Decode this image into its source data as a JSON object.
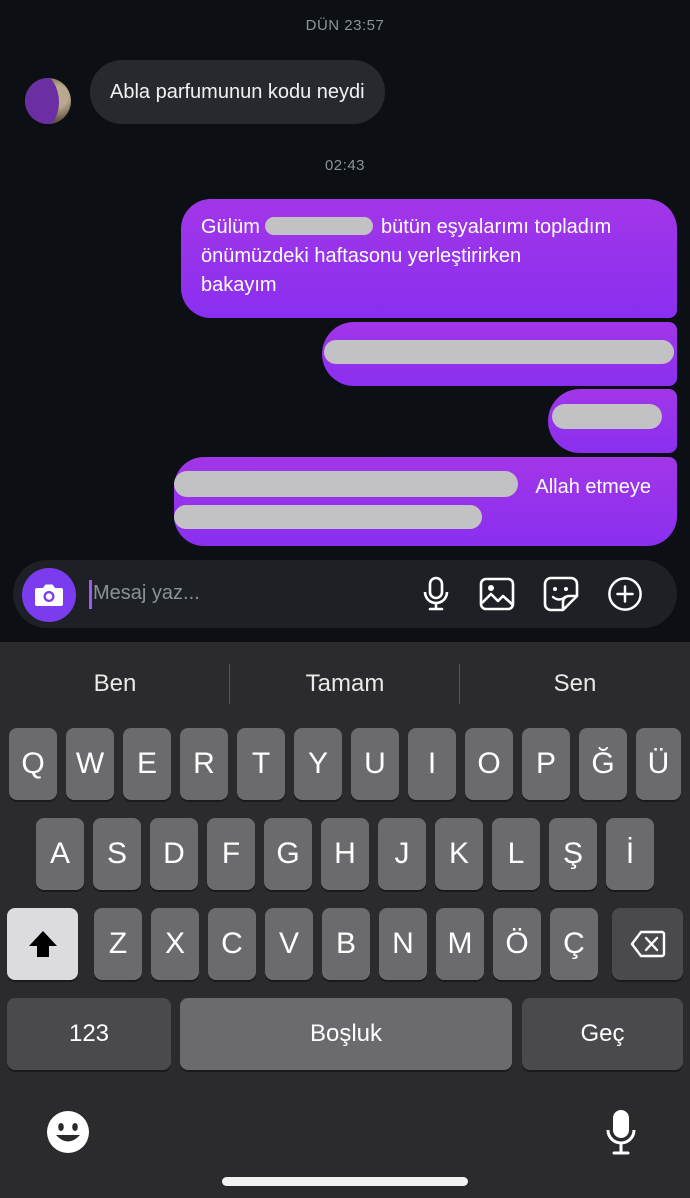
{
  "chat": {
    "timestamp_1": "DÜN 23:57",
    "incoming_message": "Abla parfumunun kodu neydi",
    "timestamp_2": "02:43",
    "outgoing": {
      "msg1_start": "Gülüm",
      "msg1_rest_line1": "bütün eşyalarımı topladım",
      "msg1_line2": "önümüzdeki haftasonu yerleştirirken",
      "msg1_line3": "bakayım",
      "msg4_visible": "Allah etmeye"
    }
  },
  "composer": {
    "placeholder": "Mesaj yaz..."
  },
  "keyboard": {
    "suggestions": [
      "Ben",
      "Tamam",
      "Sen"
    ],
    "row1": [
      "Q",
      "W",
      "E",
      "R",
      "T",
      "Y",
      "U",
      "I",
      "O",
      "P",
      "Ğ",
      "Ü"
    ],
    "row2": [
      "A",
      "S",
      "D",
      "F",
      "G",
      "H",
      "J",
      "K",
      "L",
      "Ş",
      "İ"
    ],
    "row3": [
      "Z",
      "X",
      "C",
      "V",
      "B",
      "N",
      "M",
      "Ö",
      "Ç"
    ],
    "numbers_label": "123",
    "space_label": "Boşluk",
    "return_label": "Geç"
  },
  "icons": {
    "camera": "camera-icon",
    "mic": "microphone-icon",
    "gallery": "image-icon",
    "sticker": "sticker-icon",
    "add": "plus-circle-icon",
    "shift": "shift-icon",
    "backspace": "backspace-icon",
    "emoji": "emoji-icon",
    "dictation": "dictation-mic-icon"
  },
  "colors": {
    "outgoing_bubble": "#8a2ff0",
    "incoming_bubble": "#262a2f",
    "background": "#0c1014",
    "camera_button": "#7b3cf0"
  }
}
